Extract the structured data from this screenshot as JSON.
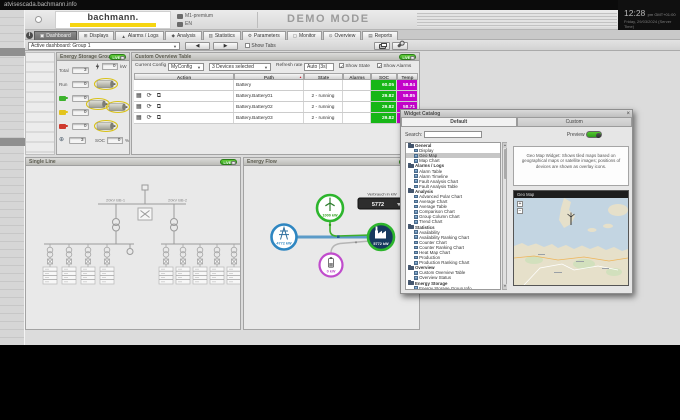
{
  "browser": {
    "url": "atvisescada.bachmann.info"
  },
  "ui": {
    "live_label": "LIVE"
  },
  "header": {
    "logo": "bachmann.",
    "edition": "M1-premium",
    "lang": "EN",
    "mode_title": "DEMO MODE",
    "clock": {
      "time": "12:28",
      "suffix": "pm GMT+01:00",
      "date": "Friday, 29/03/2024 (Server Time)"
    }
  },
  "nav": {
    "active": "Dashboard",
    "tabs": [
      {
        "label": "Dashboard",
        "icon": "dashboard-icon",
        "glyph": "▣"
      },
      {
        "label": "Displays",
        "icon": "displays-icon",
        "glyph": "⊞"
      },
      {
        "label": "Alarms / Logs",
        "icon": "alarms-icon",
        "glyph": "▲"
      },
      {
        "label": "Analysis",
        "icon": "analysis-icon",
        "glyph": "◆"
      },
      {
        "label": "Statistics",
        "icon": "statistics-icon",
        "glyph": "▥"
      },
      {
        "label": "Parameters",
        "icon": "parameters-icon",
        "glyph": "⚙"
      },
      {
        "label": "Monitor",
        "icon": "monitor-icon",
        "glyph": "▢"
      },
      {
        "label": "Overview",
        "icon": "overview-icon",
        "glyph": "⊙"
      },
      {
        "label": "Reports",
        "icon": "reports-icon",
        "glyph": "▤"
      }
    ]
  },
  "toolbar": {
    "dashboard_select": "Active dashboard: Group 1",
    "show_tabs": "Show Tabs"
  },
  "energy_storage": {
    "title": "Energy Storage Group Info",
    "rows": [
      {
        "label": "Total",
        "value": "3"
      },
      {
        "label": "Run",
        "value": "0"
      },
      {
        "icon": "battery-green-icon",
        "value": "0"
      },
      {
        "icon": "battery-yellow-icon",
        "value": "0"
      },
      {
        "icon": "battery-red-icon",
        "value": "0"
      },
      {
        "icon": "globe-icon",
        "value": "3"
      }
    ],
    "power": {
      "value": "0",
      "unit": "kW"
    },
    "soc": {
      "label": "SOC",
      "value": "0",
      "unit": "%"
    }
  },
  "overview_table": {
    "title": "Custom Overview Table",
    "controls": {
      "config_label": "Current Config",
      "config_value": "MyConfig",
      "devices_value": "3 Devices selected",
      "refresh_label": "Refresh rate",
      "refresh_value": "Auto (3s)",
      "show_state": "Show State",
      "show_alarms": "Show Alarms"
    },
    "columns": [
      "Action",
      "Path",
      "State",
      "Alarms",
      "SOC",
      "Temp"
    ],
    "soc_color": "#17b617",
    "temp_color": "#c303c9",
    "rows": [
      {
        "path": "Battery",
        "state": "",
        "alarms": "",
        "soc": "60.05",
        "temp": "58.84",
        "has_actions": false
      },
      {
        "path": "Battery.Battery01",
        "state": "2 - running",
        "alarms": "",
        "soc": "29.82",
        "temp": "58.85",
        "has_actions": true
      },
      {
        "path": "Battery.Battery02",
        "state": "2 - running",
        "alarms": "",
        "soc": "29.82",
        "temp": "58.71",
        "has_actions": true
      },
      {
        "path": "Battery.Battery03",
        "state": "2 - running",
        "alarms": "",
        "soc": "29.82",
        "temp": "58.87",
        "has_actions": true
      }
    ]
  },
  "single_line": {
    "title": "Single Line",
    "bus1_label": "20kV BB-1",
    "bus2_label": "20kV BB-2"
  },
  "energy_flow": {
    "title": "Energy Flow",
    "consumption_label": "Verbrauch in kW",
    "consumption_value": "5772",
    "nodes": {
      "wind": {
        "value": "1000 kW"
      },
      "grid": {
        "value": "4772 kW"
      },
      "plant": {
        "value": "5772 kW"
      },
      "battery": {
        "value": "0 kW"
      }
    }
  },
  "widget_catalog": {
    "title": "Widget Catalog",
    "tabs": [
      "Default",
      "Custom"
    ],
    "search_label": "Search:",
    "preview_label": "Preview",
    "description": "Geo Map Widget: Shows tiled maps based on geographical maps or satellite images; positions of devices are shown as overlay icons.",
    "map_title": "Geo Map",
    "selected_item": "Geo Map",
    "tree": [
      {
        "folder": "General",
        "items": [
          "Display",
          "Geo Map",
          "Map Chart"
        ]
      },
      {
        "folder": "Alarms / Logs",
        "items": [
          "Alarm Table",
          "Alarm Timeline",
          "Fault Analysis Chart",
          "Fault Analysis Table"
        ]
      },
      {
        "folder": "Analysis",
        "items": [
          "Advanced Polar Chart",
          "Average Chart",
          "Average Table",
          "Comparison Chart",
          "Group Column Chart",
          "Trend Chart"
        ]
      },
      {
        "folder": "Statistics",
        "items": [
          "Availability",
          "Availability Ranking Chart",
          "Counter Chart",
          "Counter Ranking Chart",
          "Heat Map Chart",
          "Production",
          "Production Ranking Chart"
        ]
      },
      {
        "folder": "Overview",
        "items": [
          "Custom Overview Table",
          "Overview Status"
        ]
      },
      {
        "folder": "Energy Storage",
        "items": [
          "Energy Storage Group Info"
        ]
      }
    ]
  }
}
